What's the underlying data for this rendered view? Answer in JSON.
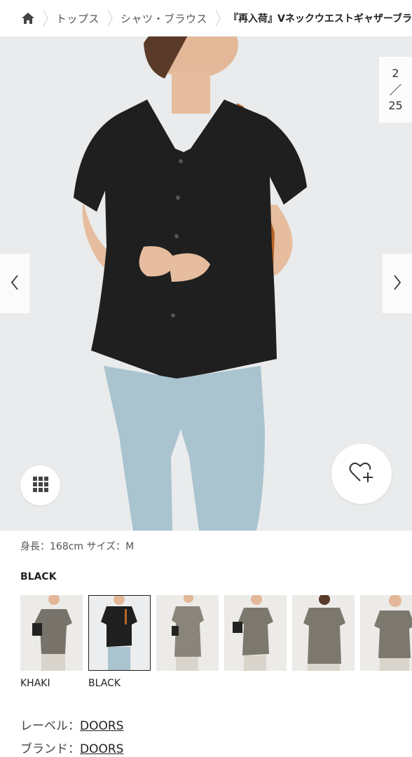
{
  "breadcrumb": {
    "items": [
      "トップス",
      "シャツ・ブラウス"
    ],
    "current": "『再入荷』Vネックウエストギャザーブラ"
  },
  "gallery": {
    "counter": {
      "current": "2",
      "total": "25"
    },
    "icons": {
      "home": "home-icon",
      "prev": "chevron-left-icon",
      "next": "chevron-right-icon",
      "grid": "grid-icon",
      "favorite": "heart-plus-icon"
    }
  },
  "product": {
    "model_info": "身長：168cm サイズ：M",
    "selected_color": "BLACK",
    "swatches": [
      {
        "label": "KHAKI",
        "selected": false
      },
      {
        "label": "BLACK",
        "selected": true
      },
      {
        "label": "",
        "selected": false
      },
      {
        "label": "",
        "selected": false
      },
      {
        "label": "",
        "selected": false
      },
      {
        "label": "",
        "selected": false
      }
    ],
    "label_row": {
      "key": "レーベル：",
      "value": "DOORS"
    },
    "brand_row": {
      "key": "ブランド：",
      "value": "DOORS"
    }
  },
  "colors": {
    "shirt_black": "#1f1f1f",
    "shirt_khaki": "#77736a",
    "jeans": "#a9c3cf",
    "skin": "#e9c2a6",
    "bag": "#b8642a",
    "background": "#e9ebec"
  }
}
